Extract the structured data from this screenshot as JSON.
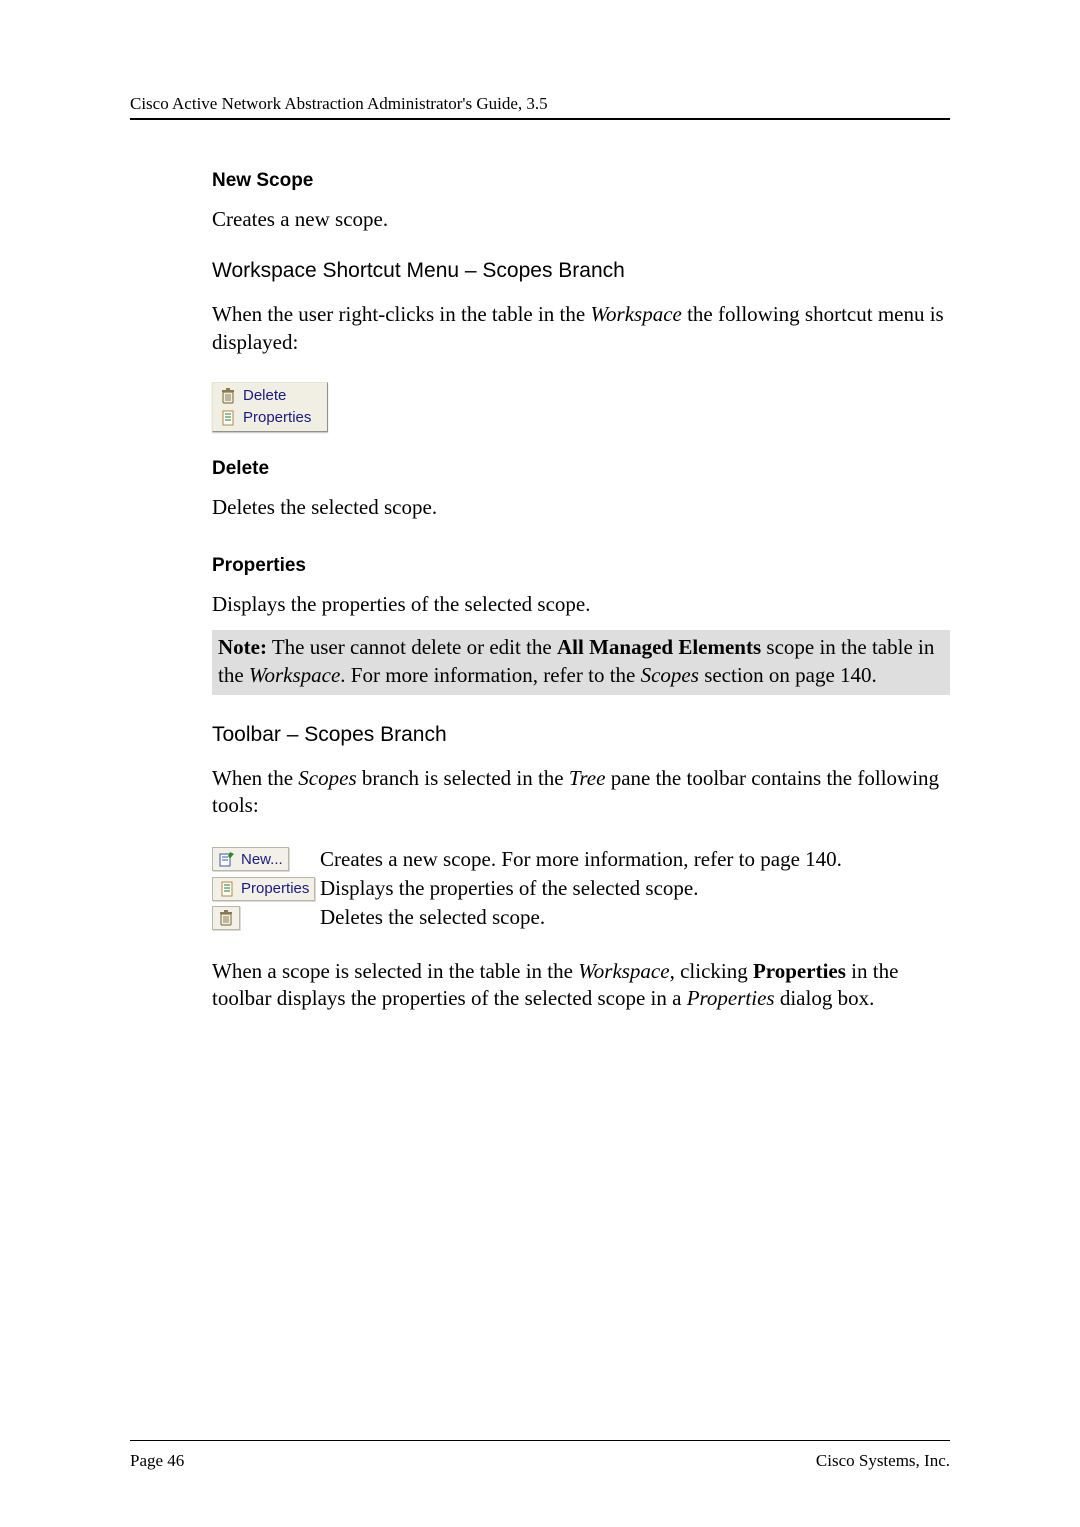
{
  "header": "Cisco Active Network Abstraction Administrator's Guide, 3.5",
  "s1": {
    "title": "New Scope",
    "body": "Creates a new scope."
  },
  "s2": {
    "title": "Workspace Shortcut Menu – Scopes Branch",
    "body_pre": "When the user right-clicks in the table in the ",
    "body_em": "Workspace",
    "body_post": " the following shortcut menu is displayed:"
  },
  "menu": {
    "delete": "Delete",
    "properties": "Properties"
  },
  "s3": {
    "title": "Delete",
    "body": "Deletes the selected scope."
  },
  "s4": {
    "title": "Properties",
    "body": "Displays the properties of the selected scope."
  },
  "note": {
    "label": "Note:",
    "t1": " The user cannot delete or edit the ",
    "b1": "All Managed Elements",
    "t2": " scope in the table in the ",
    "i1": "Workspace",
    "t3": ". For more information, refer to the ",
    "i2": "Scopes",
    "t4": " section on page 140."
  },
  "s5": {
    "title": "Toolbar – Scopes Branch",
    "body_pre": "When the ",
    "body_em1": "Scopes",
    "body_mid": " branch is selected in the ",
    "body_em2": "Tree",
    "body_post": " pane the toolbar contains the following tools:"
  },
  "tools": {
    "new_label": "New...",
    "new_desc": "Creates a new scope. For more information, refer to page 140.",
    "props_label": "Properties",
    "props_desc": "Displays the properties of the selected scope.",
    "del_desc": "Deletes the selected scope."
  },
  "s6": {
    "t1": "When a scope is selected in the table in the ",
    "i1": "Workspace",
    "t2": ", clicking ",
    "b1": "Properties",
    "t3": " in the toolbar displays the properties of the selected scope in a ",
    "i2": "Properties",
    "t4": " dialog box."
  },
  "footer": {
    "left": "Page 46",
    "right": "Cisco Systems, Inc."
  }
}
